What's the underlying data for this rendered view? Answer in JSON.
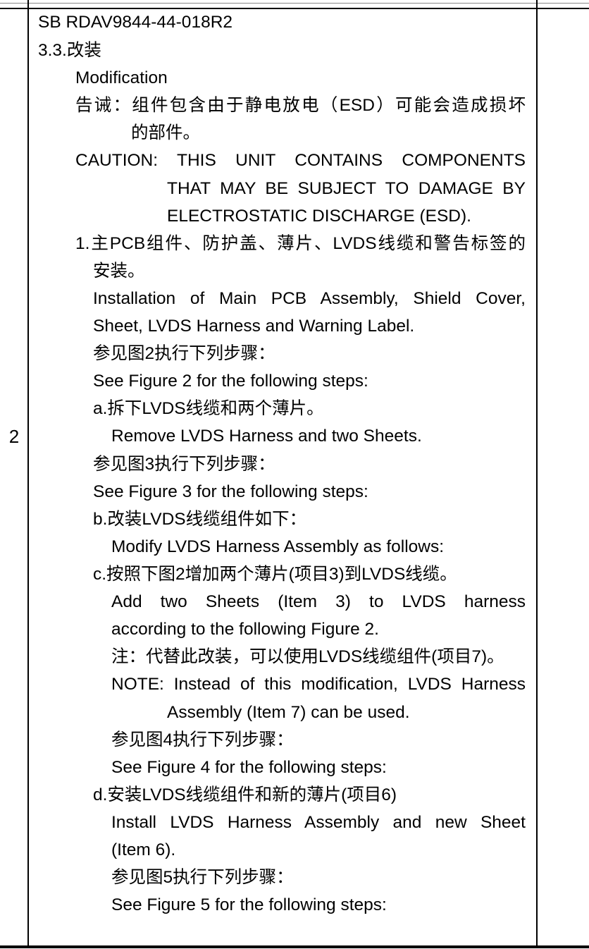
{
  "document": {
    "row_number": "2",
    "sb_number": "SB RDAV9844-44-018R2",
    "section_heading": "3.3.改装",
    "section_heading_en": "Modification",
    "caution_cn_line1": "告诫：组件包含由于静电放电（ESD）可能会造成损坏",
    "caution_cn_line2": "的部件。",
    "caution_en_line1": "CAUTION: THIS UNIT CONTAINS COMPONENTS",
    "caution_en_line2": "THAT MAY BE SUBJECT TO DAMAGE BY",
    "caution_en_line3": "ELECTROSTATIC DISCHARGE (ESD).",
    "step1_cn_line1": "1.主PCB组件、防护盖、薄片、LVDS线缆和警告标签的",
    "step1_cn_line2": "安装。",
    "step1_en_line1": "Installation of Main PCB Assembly, Shield Cover,",
    "step1_en_line2": "Sheet, LVDS Harness and Warning Label.",
    "fig2_cn": "参见图2执行下列步骤：",
    "fig2_en": "See Figure 2 for the following steps:",
    "step_a_cn": "a.拆下LVDS线缆和两个薄片。",
    "step_a_en": "Remove LVDS Harness and two Sheets.",
    "fig3_cn": "参见图3执行下列步骤：",
    "fig3_en": "See Figure 3 for the following steps:",
    "step_b_cn": "b.改装LVDS线缆组件如下：",
    "step_b_en": "Modify LVDS Harness Assembly as follows:",
    "step_c_cn": "c.按照下图2增加两个薄片(项目3)到LVDS线缆。",
    "step_c_en_line1": "Add two Sheets (Item 3) to LVDS harness",
    "step_c_en_line2": "according to the following Figure 2.",
    "note_cn": "注：代替此改装，可以使用LVDS线缆组件(项目7)。",
    "note_en_line1": "NOTE: Instead of this modification, LVDS Harness",
    "note_en_line2": "Assembly (Item 7) can be used.",
    "fig4_cn": "参见图4执行下列步骤：",
    "fig4_en": "See Figure 4 for the following steps:",
    "step_d_cn": "d.安装LVDS线缆组件和新的薄片(项目6)",
    "step_d_en_line1": "Install LVDS Harness Assembly and new Sheet",
    "step_d_en_line2": "(Item 6).",
    "fig5_cn": "参见图5执行下列步骤：",
    "fig5_en": "See Figure 5 for the following steps:"
  }
}
